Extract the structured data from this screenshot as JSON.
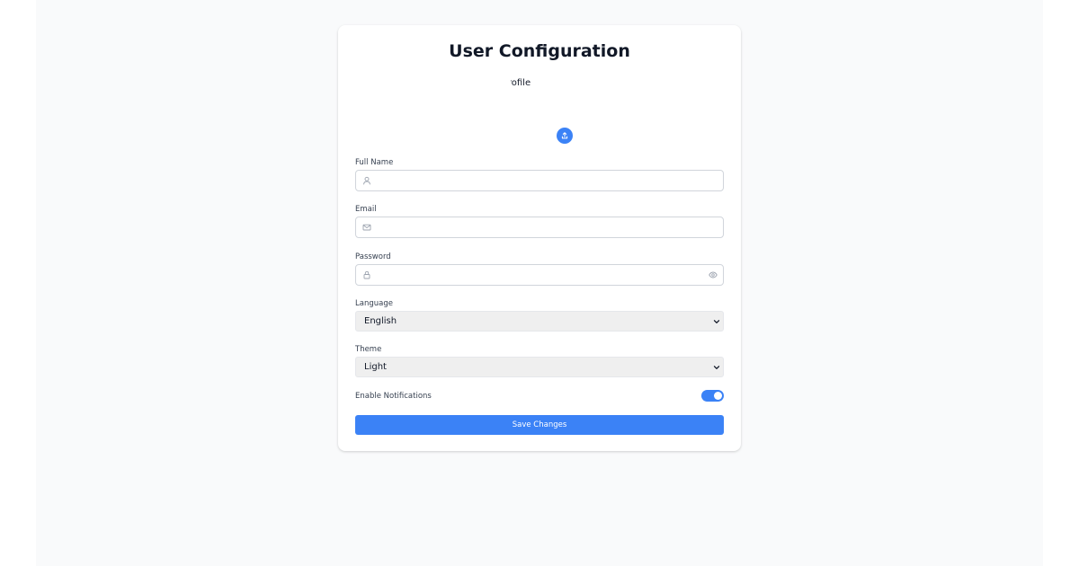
{
  "page": {
    "title": "User Configuration"
  },
  "avatar": {
    "alt_text": "Profile",
    "upload_icon": "upload-icon"
  },
  "fields": {
    "full_name": {
      "label": "Full Name",
      "value": "",
      "placeholder": "",
      "icon": "user-icon"
    },
    "email": {
      "label": "Email",
      "value": "",
      "placeholder": "",
      "icon": "mail-icon"
    },
    "password": {
      "label": "Password",
      "value": "",
      "placeholder": "",
      "icon": "lock-icon",
      "reveal_icon": "eye-icon"
    }
  },
  "selects": {
    "language": {
      "label": "Language",
      "selected": "English"
    },
    "theme": {
      "label": "Theme",
      "selected": "Light"
    }
  },
  "notifications": {
    "label": "Enable Notifications",
    "enabled": true
  },
  "actions": {
    "save_label": "Save Changes"
  },
  "colors": {
    "accent": "#3b82f6",
    "page_background": "#f9fafb",
    "card_background": "#ffffff",
    "select_background": "#efefef",
    "input_border": "#d1d5db"
  }
}
